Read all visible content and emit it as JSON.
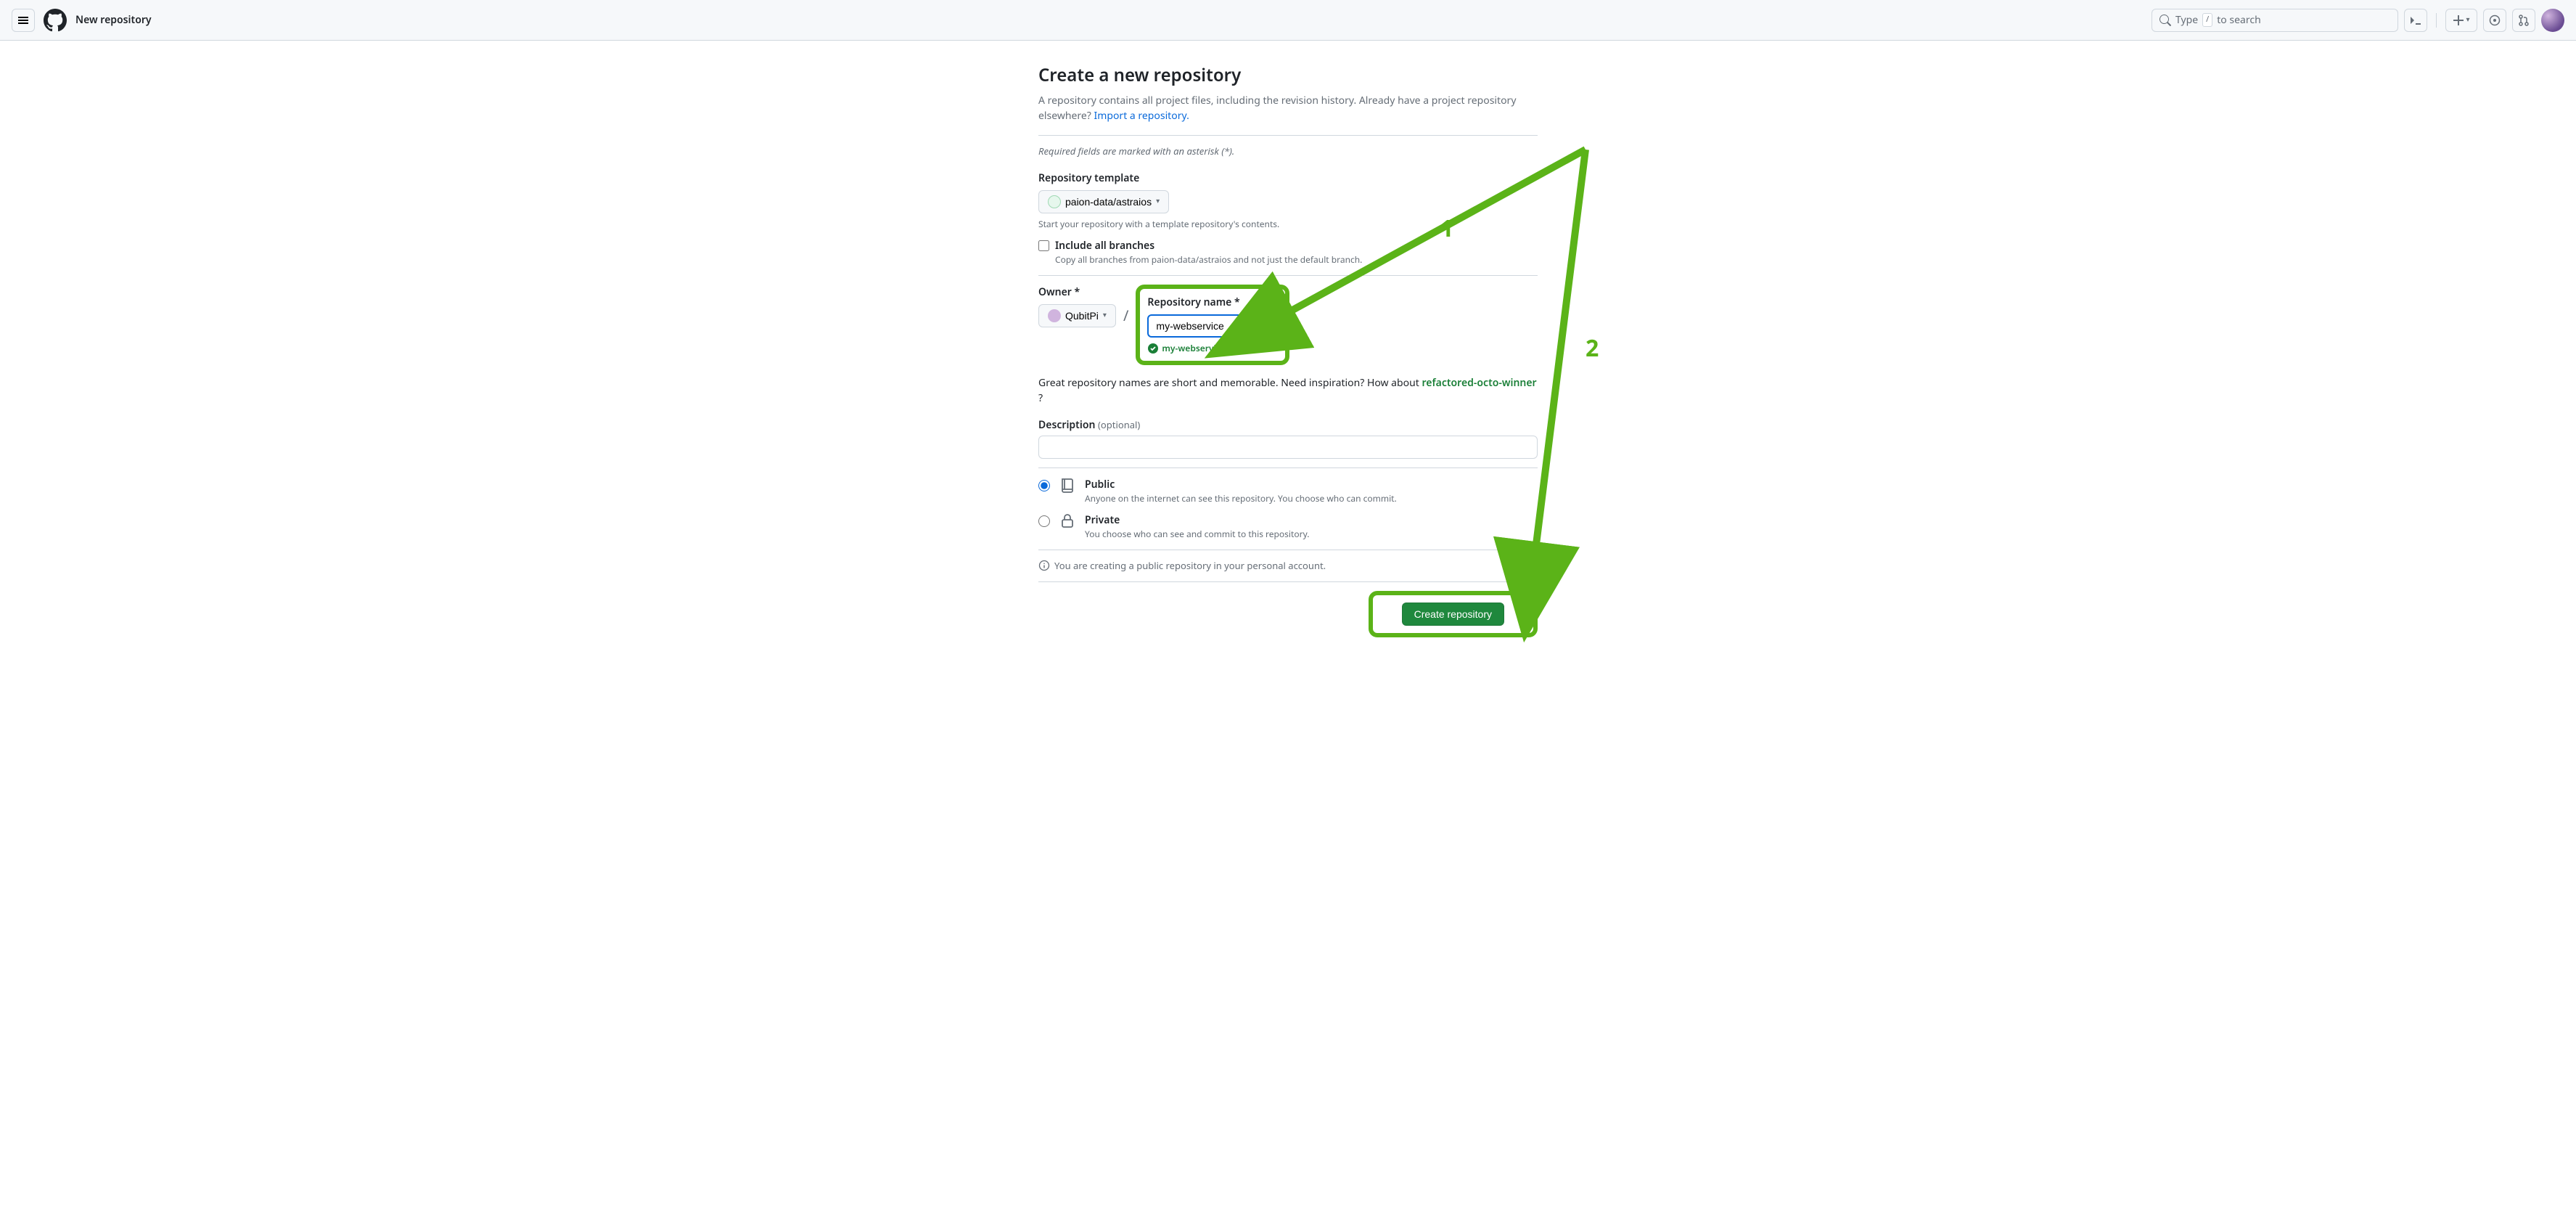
{
  "header": {
    "page_title": "New repository",
    "search_placeholder_pre": "Type",
    "search_slash": "/",
    "search_placeholder_post": "to search"
  },
  "main": {
    "title": "Create a new repository",
    "subtitle_pre": "A repository contains all project files, including the revision history. Already have a project repository elsewhere? ",
    "subtitle_link": "Import a repository.",
    "required_note": "Required fields are marked with an asterisk (*).",
    "template": {
      "label": "Repository template",
      "selected": "paion-data/astraios",
      "help": "Start your repository with a template repository's contents."
    },
    "include_branches": {
      "label": "Include all branches",
      "sub": "Copy all branches from paion-data/astraios and not just the default branch.",
      "checked": false
    },
    "owner": {
      "label": "Owner *",
      "selected": "QubitPi"
    },
    "repo_name": {
      "label": "Repository name *",
      "value": "my-webservice",
      "available_msg": "my-webservice is available."
    },
    "inspiration": {
      "pre": "Great repository names are short and memorable. Need inspiration? How about ",
      "suggestion": "refactored-octo-winner",
      "post": " ?"
    },
    "description": {
      "label": "Description",
      "optional": "(optional)",
      "value": ""
    },
    "visibility": {
      "public": {
        "title": "Public",
        "sub": "Anyone on the internet can see this repository. You choose who can commit.",
        "selected": true
      },
      "private": {
        "title": "Private",
        "sub": "You choose who can see and commit to this repository.",
        "selected": false
      }
    },
    "info_note": "You are creating a public repository in your personal account.",
    "submit_label": "Create repository"
  },
  "annotations": {
    "num1": "1",
    "num2": "2"
  }
}
